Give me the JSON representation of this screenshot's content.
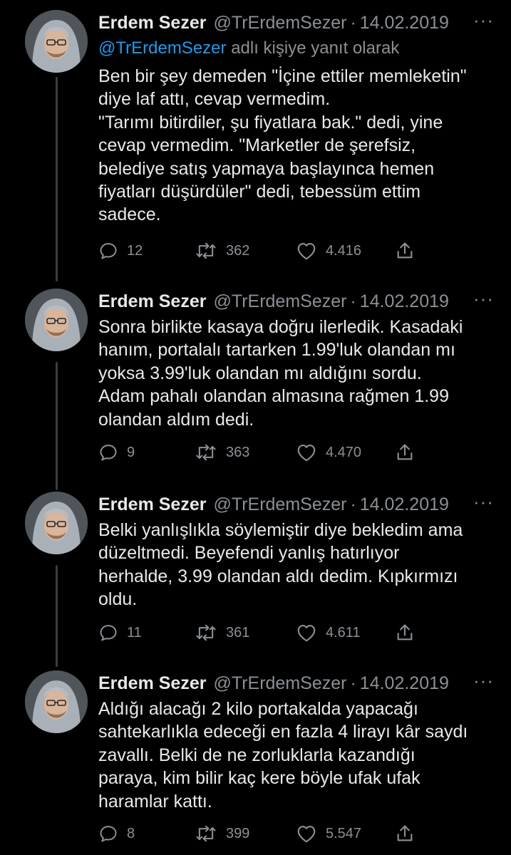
{
  "author": {
    "name": "Erdem Sezer",
    "handle": "@TrErdemSezer",
    "separator": "·",
    "more_glyph": "···"
  },
  "reply_context": {
    "mention": "@TrErdemSezer",
    "suffix": "adlı kişiye yanıt olarak"
  },
  "colors": {
    "background": "#000000",
    "text": "#e7e9ea",
    "secondary": "#8b9096",
    "mention": "#1d9bf0",
    "thread_line": "#3a3d41"
  },
  "tweets": [
    {
      "date": "14.02.2019",
      "text": "Ben bir şey demeden \"İçine ettiler memleketin\"\ndiye laf attı, cevap vermedim.\n\"Tarımı bitirdiler, şu fiyatlara bak.\" dedi, yine\ncevap vermedim. \"Marketler de şerefsiz,\nbelediye satış yapmaya başlayınca hemen\nfiyatları düşürdüler\" dedi, tebessüm ettim\nsadece.",
      "replies": "12",
      "retweets": "362",
      "likes": "4.416"
    },
    {
      "date": "14.02.2019",
      "text": "Sonra birlikte kasaya doğru ilerledik. Kasadaki\nhanım, portalalı tartarken 1.99'luk olandan mı\nyoksa 3.99'luk olandan mı aldığını sordu.\nAdam pahalı olandan almasına rağmen 1.99\nolandan aldım dedi.",
      "replies": "9",
      "retweets": "363",
      "likes": "4.470"
    },
    {
      "date": "14.02.2019",
      "text": "Belki yanlışlıkla söylemiştir diye bekledim ama\ndüzeltmedi. Beyefendi yanlış hatırlıyor\nherhalde, 3.99 olandan aldı dedim. Kıpkırmızı\noldu.",
      "replies": "11",
      "retweets": "361",
      "likes": "4.611"
    },
    {
      "date": "14.02.2019",
      "text": "Aldığı alacağı 2 kilo portakalda yapacağı\nsahtekarlıkla edeceği en fazla 4 lirayı kâr saydı\nzavallı. Belki de ne zorluklarla kazandığı\nparaya, kim bilir kaç kere böyle ufak ufak\nharamlar kattı.",
      "replies": "8",
      "retweets": "399",
      "likes": "5.547"
    }
  ]
}
